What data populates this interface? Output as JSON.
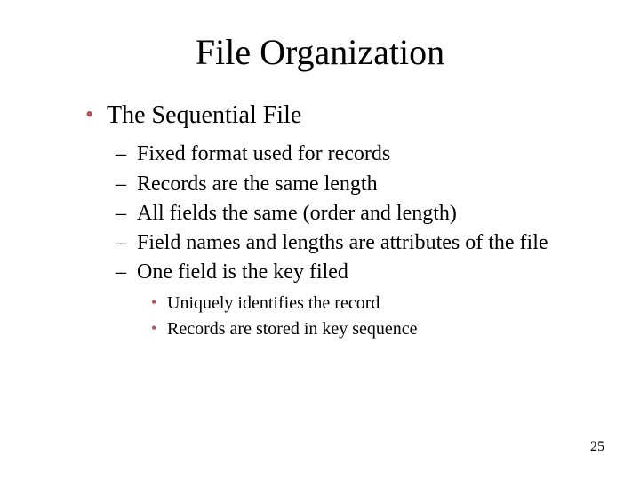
{
  "title": "File Organization",
  "bullets": {
    "l1": {
      "item0": "The Sequential File"
    },
    "l2": {
      "item0": "Fixed format used for records",
      "item1": "Records are the same length",
      "item2": "All fields the same (order and length)",
      "item3": "Field names and lengths are attributes of the file",
      "item4": "One field is the key filed"
    },
    "l3": {
      "item0": "Uniquely identifies the record",
      "item1": "Records are stored in key sequence"
    }
  },
  "page_number": "25"
}
